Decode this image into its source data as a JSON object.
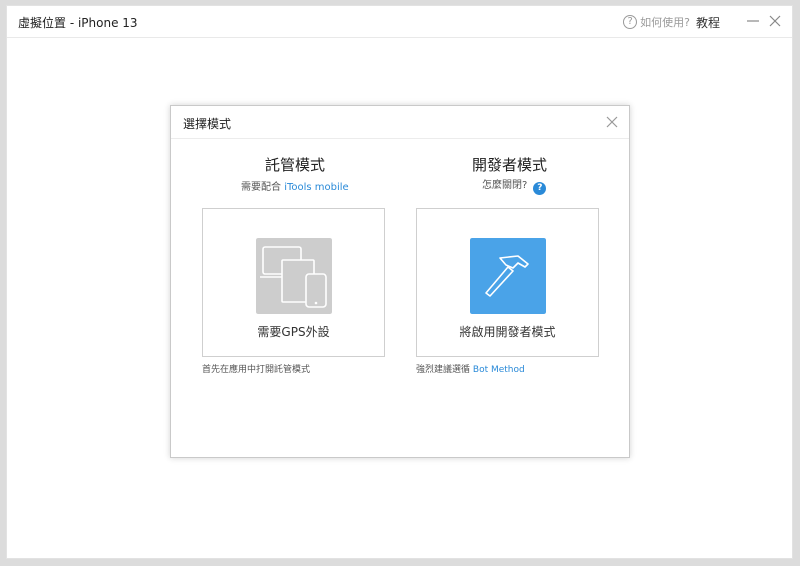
{
  "window": {
    "title": "虛擬位置 - iPhone 13",
    "help_label": "如何使用?",
    "tutorial_label": "教程"
  },
  "dialog": {
    "title": "選擇模式",
    "hosted": {
      "title": "託管模式",
      "subtitle_prefix": "需要配合",
      "subtitle_link": "iTools mobile",
      "card_label": "需要GPS外設",
      "note": "首先在應用中打開託管模式",
      "icon": "devices-icon"
    },
    "developer": {
      "title": "開發者模式",
      "subtitle": "怎麼關閉?",
      "card_label": "將啟用開發者模式",
      "note_prefix": "強烈建議選循",
      "note_link": "Bot Method",
      "icon": "hammer-icon"
    }
  },
  "colors": {
    "accent": "#2a8ad8",
    "hammer_tile": "#4aa3e8",
    "devices_tile": "#cdcdcd"
  }
}
